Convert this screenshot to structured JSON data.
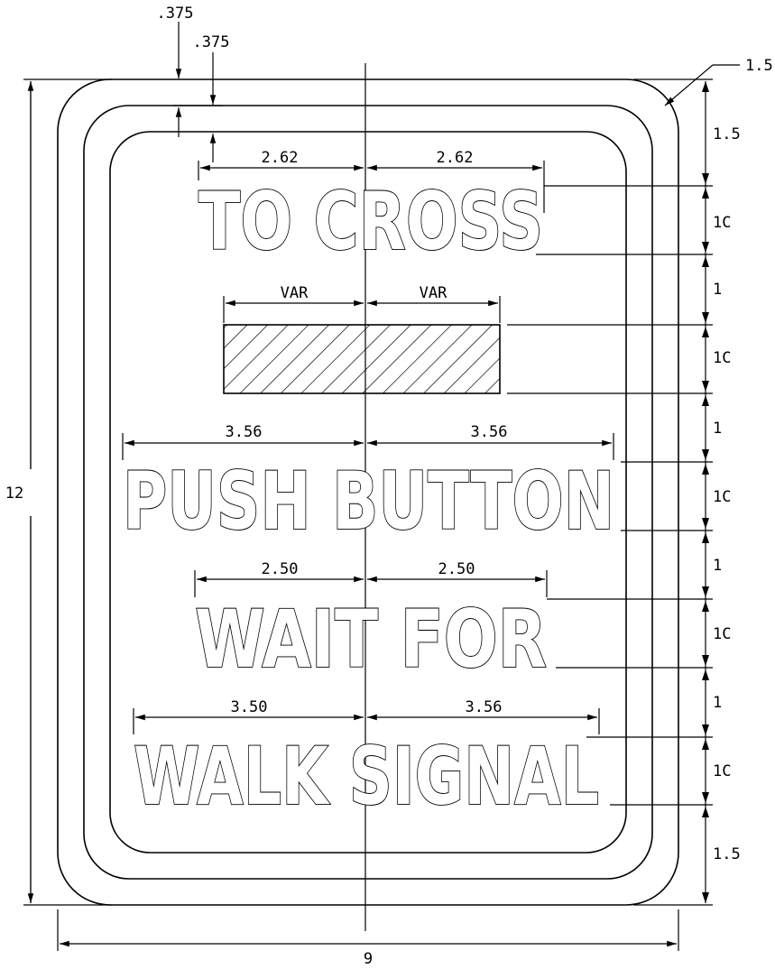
{
  "dimensions": {
    "border_outer_offset": ".375",
    "border_inner_offset": ".375",
    "corner_radius": "1.5",
    "overall_height": "12",
    "overall_width": "9",
    "line1_left": "2.62",
    "line1_right": "2.62",
    "symbol_left": "VAR",
    "symbol_right": "VAR",
    "line2_left": "3.56",
    "line2_right": "3.56",
    "line3_left": "2.50",
    "line3_right": "2.50",
    "line4_left": "3.50",
    "line4_right": "3.56"
  },
  "vertical_spacing": [
    "1.5",
    "1C",
    "1",
    "1C",
    "1",
    "1C",
    "1",
    "1C",
    "1",
    "1C",
    "1.5"
  ],
  "legend": {
    "line1": "TO CROSS",
    "line2": "PUSH BUTTON",
    "line3": "WAIT FOR",
    "line4": "WALK SIGNAL"
  }
}
